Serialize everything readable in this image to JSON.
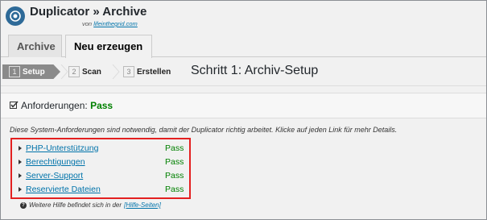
{
  "header": {
    "title": "Duplicator » Archive",
    "byline_prefix": "von",
    "byline_link": "lifeinthegrid.com"
  },
  "tabs": [
    {
      "label": "Archive",
      "active": false
    },
    {
      "label": "Neu erzeugen",
      "active": true
    }
  ],
  "steps": [
    {
      "num": "1",
      "label": "Setup",
      "active": true
    },
    {
      "num": "2",
      "label": "Scan",
      "active": false
    },
    {
      "num": "3",
      "label": "Erstellen",
      "active": false
    }
  ],
  "step_title": "Schritt 1: Archiv-Setup",
  "requirements": {
    "label": "Anforderungen:",
    "status": "Pass",
    "description": "Diese System-Anforderungen sind notwendig, damit der Duplicator richtig arbeitet. Klicke auf jeden Link für mehr Details.",
    "items": [
      {
        "label": "PHP-Unterstützung",
        "status": "Pass"
      },
      {
        "label": "Berechtigungen",
        "status": "Pass"
      },
      {
        "label": "Server-Support",
        "status": "Pass"
      },
      {
        "label": "Reservierte Dateien",
        "status": "Pass"
      }
    ],
    "help_text": "Weitere Hilfe befindet sich in der",
    "help_link": "[Hilfe-Seiten]"
  },
  "colors": {
    "pass": "#008000",
    "link": "#0073aa",
    "highlight_box": "#e32020",
    "active_step": "#8a8a8a"
  },
  "icons": {
    "logo": "duplicator-logo-icon",
    "check": "checkbox-check-icon",
    "arrow": "triangle-right-icon",
    "help": "question-circle-icon"
  }
}
